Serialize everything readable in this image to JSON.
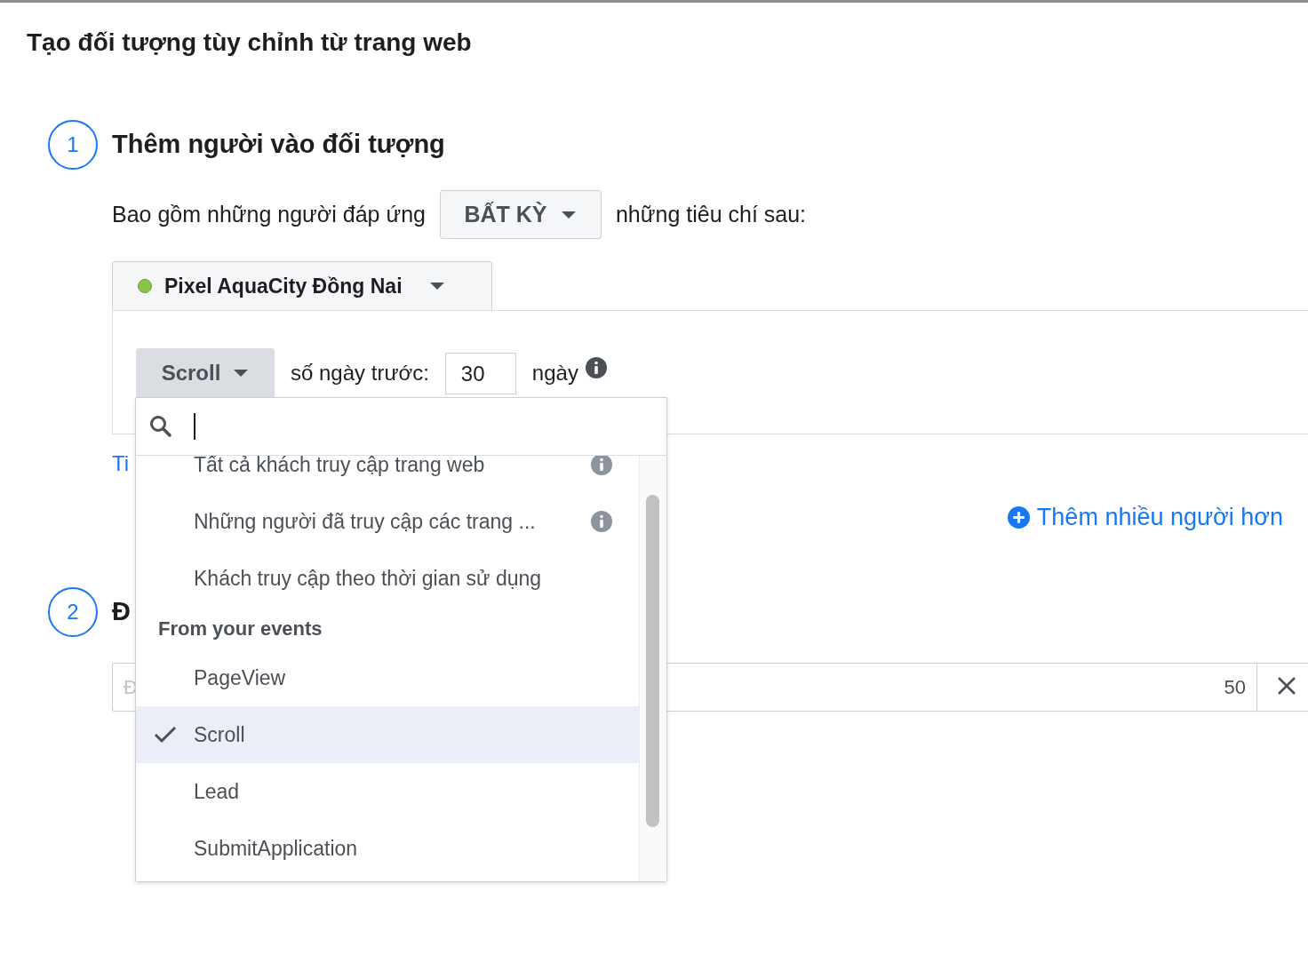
{
  "dialog": {
    "title": "Tạo đối tượng tùy chỉnh từ trang web"
  },
  "steps": [
    {
      "number": "1",
      "title": "Thêm người vào đối tượng"
    },
    {
      "number": "2",
      "title": "Đ"
    }
  ],
  "include_row": {
    "prefix": "Bao gồm những người đáp ứng",
    "match_button": "BẤT KỲ",
    "suffix": "những tiêu chí sau:"
  },
  "pixel": {
    "name": "Pixel AquaCity Đồng Nai",
    "active": true
  },
  "rule": {
    "event_button": "Scroll",
    "days_label": "số ngày trước:",
    "days_value": "30",
    "days_unit": "ngày"
  },
  "link_partial": "Ti",
  "add_more": "Thêm nhiều người hơn",
  "name_field": {
    "placeholder": "Đ",
    "counter": "50"
  },
  "dropdown": {
    "items": [
      {
        "kind": "option",
        "label": "Tất cả khách truy cập trang web",
        "info": true,
        "selected": false
      },
      {
        "kind": "option",
        "label": "Những người đã truy cập các trang ...",
        "info": true,
        "selected": false
      },
      {
        "kind": "option",
        "label": "Khách truy cập theo thời gian sử dụng",
        "info": false,
        "selected": false
      },
      {
        "kind": "header",
        "label": "From your events"
      },
      {
        "kind": "option",
        "label": "PageView",
        "info": false,
        "selected": false
      },
      {
        "kind": "option",
        "label": "Scroll",
        "info": false,
        "selected": true
      },
      {
        "kind": "option",
        "label": "Lead",
        "info": false,
        "selected": false
      },
      {
        "kind": "option",
        "label": "SubmitApplication",
        "info": false,
        "selected": false
      }
    ]
  }
}
